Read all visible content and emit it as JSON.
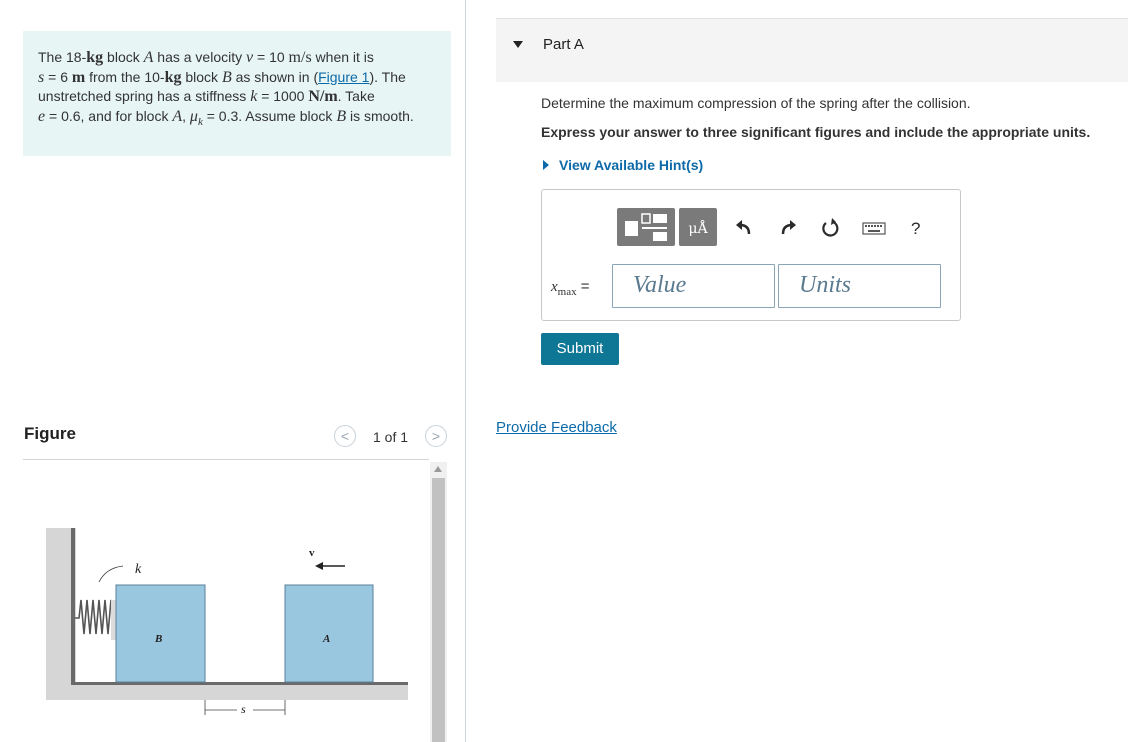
{
  "problem": {
    "t1": "The 18-",
    "kg": "kg",
    "t2": " block ",
    "blockA": "A",
    "t3": " has a velocity ",
    "v": "v",
    "t4": " = 10 ",
    "vunit": "m/s",
    "t5": " when it is",
    "s": "s",
    "t6": " = 6 ",
    "m": "m",
    "t7": " from the 10-",
    "kg2": "kg",
    "t8": " block ",
    "blockB": "B",
    "t9": " as shown in (",
    "figlink": "Figure 1",
    "t10": "). The unstretched spring has a stiffness ",
    "k": "k",
    "t11": " = 1000 ",
    "kunit": "N/m",
    "t12": ". Take",
    "e": "e",
    "t13": " = 0.6, and for block ",
    "blockA2": "A",
    "t14": ", ",
    "mu": "μ",
    "muk": "k",
    "t15": " = 0.3. Assume block ",
    "blockB2": "B",
    "t16": " is smooth."
  },
  "part": {
    "title": "Part A",
    "question": "Determine the maximum compression of the spring after the collision.",
    "instruction": "Express your answer to three significant figures and include the appropriate units.",
    "hint": "View Available Hint(s)",
    "toolbar": {
      "units_btn": "μÅ",
      "help": "?"
    },
    "eq_var": "x",
    "eq_sub": "max",
    "eq_sign": " =",
    "value_placeholder": "Value",
    "units_placeholder": "Units",
    "submit": "Submit",
    "feedback": "Provide Feedback"
  },
  "figure": {
    "title": "Figure",
    "pager": "1 of 1",
    "prev": "<",
    "next": ">",
    "label_k": "k",
    "label_v": "v",
    "label_B": "B",
    "label_A": "A",
    "label_s": "s"
  },
  "colors": {
    "accent": "#0d6aa8",
    "submit": "#0f7796",
    "block": "#9ac7e0",
    "statement_bg": "#e7f5f5"
  }
}
